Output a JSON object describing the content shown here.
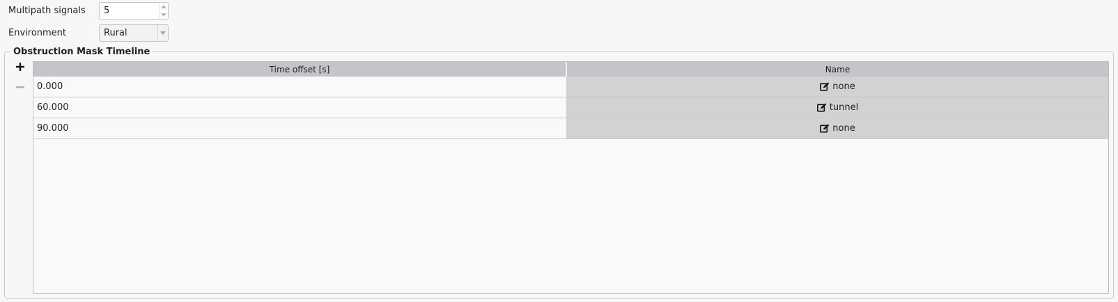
{
  "form": {
    "multipath_label": "Multipath signals",
    "multipath_value": "5",
    "environment_label": "Environment",
    "environment_value": "Rural"
  },
  "group": {
    "title": "Obstruction Mask Timeline",
    "add_icon": "plus-icon",
    "remove_icon": "minus-icon"
  },
  "table": {
    "columns": [
      "Time offset [s]",
      "Name"
    ],
    "rows": [
      {
        "time": "0.000",
        "name": "none"
      },
      {
        "time": "60.000",
        "name": "tunnel"
      },
      {
        "time": "90.000",
        "name": "none"
      }
    ],
    "edit_icon": "edit-icon"
  },
  "colors": {
    "header_bg": "#c3c5c8",
    "name_cell_bg": "#d2d2d2",
    "window_bg": "#f7f7f7"
  }
}
